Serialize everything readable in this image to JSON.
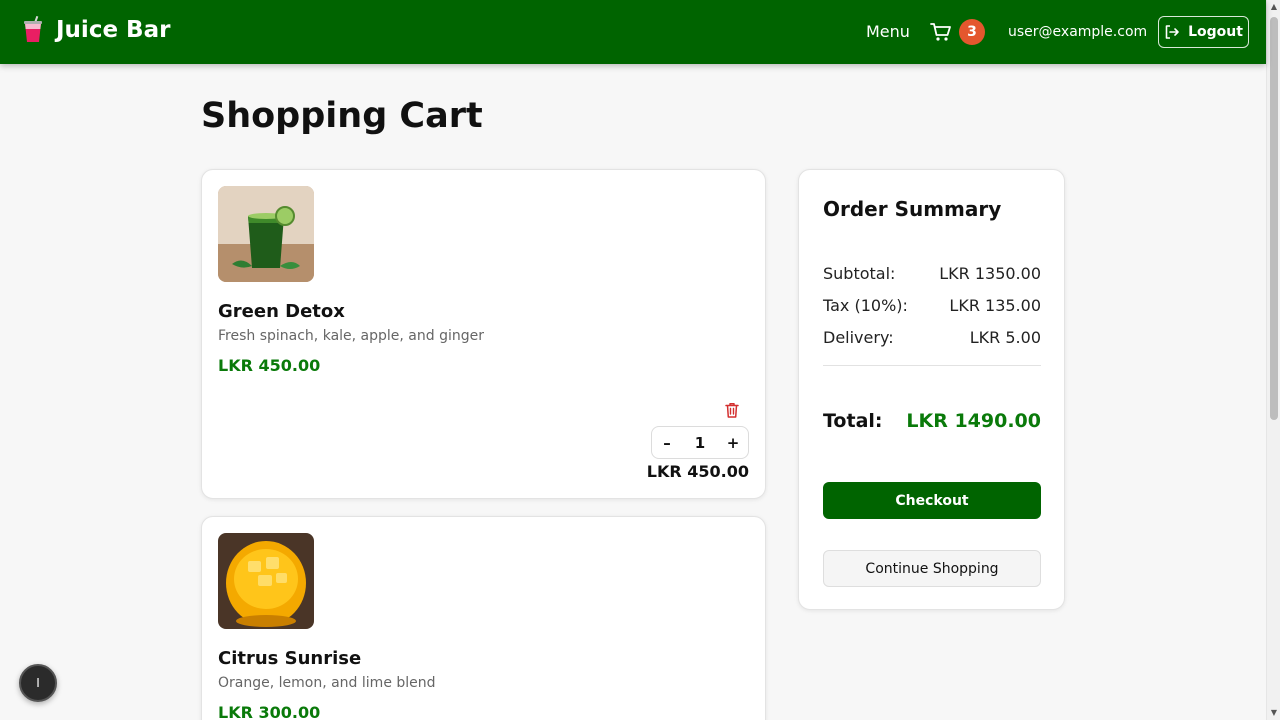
{
  "nav": {
    "brand": "Juice Bar",
    "menu": "Menu",
    "cart_count": "3",
    "user_email": "user@example.com",
    "logout": "Logout"
  },
  "page": {
    "title": "Shopping Cart"
  },
  "cart": {
    "items": [
      {
        "name": "Green Detox",
        "description": "Fresh spinach, kale, apple, and ginger",
        "price": "LKR 450.00",
        "quantity": "1",
        "line_total": "LKR 450.00",
        "image_icon": "green-juice-glass"
      },
      {
        "name": "Citrus Sunrise",
        "description": "Orange, lemon, and lime blend",
        "price": "LKR 300.00",
        "image_icon": "orange-juice-glass"
      }
    ],
    "qty_minus": "–",
    "qty_plus": "+"
  },
  "summary": {
    "title": "Order Summary",
    "subtotal_label": "Subtotal:",
    "subtotal_value": "LKR 1350.00",
    "tax_label": "Tax (10%):",
    "tax_value": "LKR 135.00",
    "delivery_label": "Delivery:",
    "delivery_value": "LKR 5.00",
    "total_label": "Total:",
    "total_value": "LKR 1490.00",
    "checkout": "Checkout",
    "continue": "Continue Shopping"
  },
  "fab": {
    "label": "I"
  },
  "colors": {
    "brand_green": "#006400",
    "price_green": "#0a7a0a",
    "badge": "#e4572e",
    "delete": "#d32f2f"
  }
}
